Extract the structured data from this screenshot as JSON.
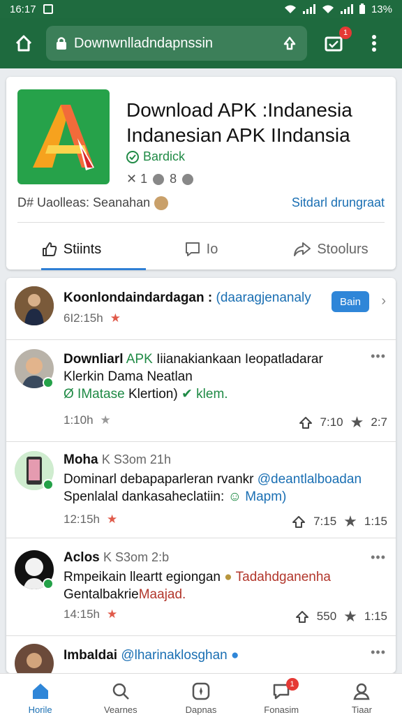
{
  "status_bar": {
    "time": "16:17",
    "battery": "13%"
  },
  "browser": {
    "url": "Downwnlladndapnssin",
    "tab_count": "1"
  },
  "app": {
    "title_line1": "Download APK :Indanesia",
    "title_line2": "Indanesian APK IIndansia",
    "developer": "Bardick",
    "stats": [
      "✕ 1",
      "8"
    ],
    "meta": "D# Uaolleas: Seanahan",
    "link": "Sitdarl drungraat",
    "tabs": [
      "Stiints",
      "Io",
      "Stoolurs"
    ],
    "colors": {
      "accent": "#1e6a3e",
      "link": "#1a6fb3",
      "green": "#1f8a45"
    }
  },
  "posts": [
    {
      "name": "Koonlondaindardagan :",
      "handle": "(daaragjenanaly",
      "time": "6I2:15h",
      "follow_label": "Bain"
    },
    {
      "text_line1_a": "Downliarl",
      "text_line1_b": "APK",
      "text_line1_c": "Iiianakiankaan Ieopatladarar",
      "text_line2": "Klerkin Dama Neatlan",
      "text_line3_a": "Ø IMatase",
      "text_line3_b": "Klertion)",
      "text_line3_c": "✔ klem.",
      "time": "1:10h",
      "reposts": "7:10",
      "likes": "2:7"
    },
    {
      "name": "Moha",
      "meta": "K S3om 21h",
      "text_line1_a": "Dominarl debapaparleran rvankr",
      "text_line1_b": "@deantlalboadan",
      "text_line2_a": "Spenlalal dankasaheclatiin:",
      "text_line2_b": "Mapm)",
      "time": "12:15h",
      "reposts": "7:15",
      "likes": "1:15"
    },
    {
      "name": "Aclos",
      "meta": "K S3om 2:b",
      "text_line1_a": "Rmpeikain lleartt egiongan",
      "text_line1_b": "Tadahdganenha",
      "text_line2_a": "Gentalbakrie",
      "text_line2_b": "Maajad.",
      "time": "14:15h",
      "reposts": "550",
      "likes": "1:15"
    },
    {
      "name": "Imbaldai",
      "handle": "@lharinaklosghan"
    }
  ],
  "bottom_nav": [
    {
      "label": "Horile",
      "icon": "home-icon"
    },
    {
      "label": "Vearnes",
      "icon": "search-icon"
    },
    {
      "label": "Dapnas",
      "icon": "compass-icon"
    },
    {
      "label": "Fonasim",
      "icon": "chat-icon",
      "badge": "1"
    },
    {
      "label": "Tiaar",
      "icon": "profile-icon"
    }
  ]
}
